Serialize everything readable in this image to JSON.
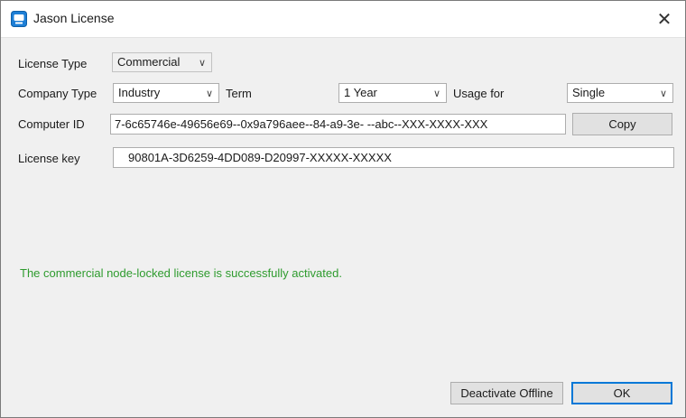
{
  "window": {
    "title": "Jason License",
    "close_label": "✕"
  },
  "form": {
    "license_type_label": "License Type",
    "license_type_value": "Commercial",
    "company_type_label": "Company Type",
    "company_type_value": "Industry",
    "term_label": "Term",
    "term_value": "1 Year",
    "usage_label": "Usage for",
    "usage_value": "Single",
    "computer_id_label": "Computer ID",
    "computer_id_value": "7-6c65746e-49656e69--0x9a796aee--84-a9-3e-   --abc--XXX-XXXX-XXX",
    "copy_label": "Copy",
    "license_key_label": "License key",
    "license_key_value": "90801A-3D6259-4DD089-D20997-XXXXX-XXXXX"
  },
  "status": {
    "message": "The commercial node-locked license is successfully activated.",
    "color": "#2e9b2e"
  },
  "buttons": {
    "deactivate_label": "Deactivate Offline",
    "ok_label": "OK"
  },
  "icons": {
    "app": "app-window-icon",
    "dropdown": "chevron-down-icon"
  }
}
